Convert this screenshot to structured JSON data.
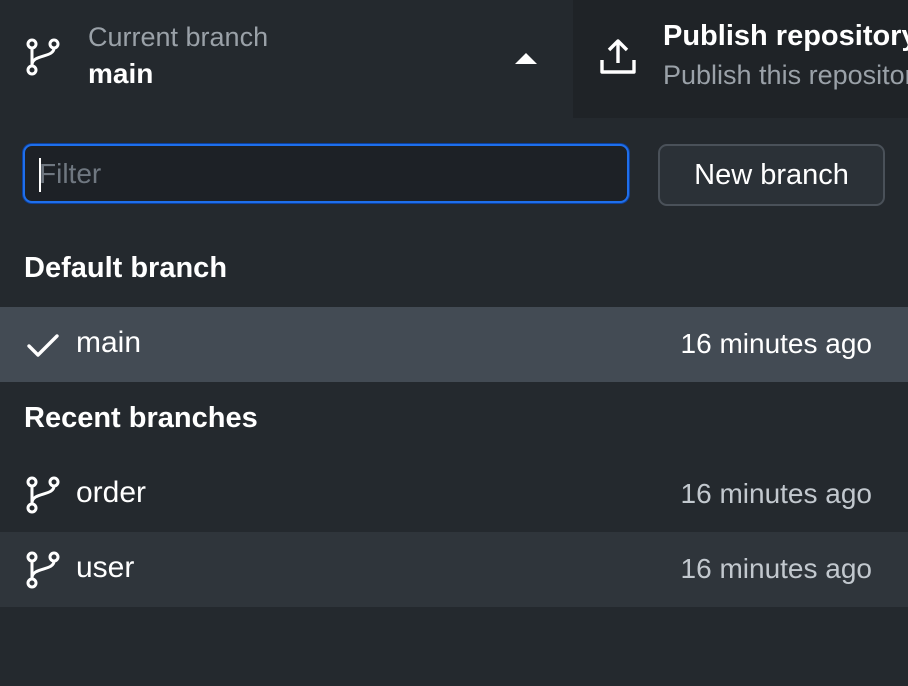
{
  "toolbar": {
    "current_branch_label": "Current branch",
    "current_branch_value": "main",
    "publish_title": "Publish repository",
    "publish_subtitle": "Publish this repository"
  },
  "filter": {
    "placeholder": "Filter",
    "value": ""
  },
  "new_branch_label": "New branch",
  "sections": {
    "default_header": "Default branch",
    "recent_header": "Recent branches"
  },
  "default_branches": [
    {
      "name": "main",
      "time": "16 minutes ago",
      "selected": true,
      "icon": "check-icon"
    }
  ],
  "recent_branches": [
    {
      "name": "order",
      "time": "16 minutes ago",
      "icon": "git-branch-icon"
    },
    {
      "name": "user",
      "time": "16 minutes ago",
      "icon": "git-branch-icon"
    }
  ],
  "colors": {
    "background": "#24292e",
    "selected_row": "#434b54",
    "hover_row": "#2f353b",
    "focus_ring": "#1f6feb",
    "muted_text": "#9aa1a8"
  }
}
